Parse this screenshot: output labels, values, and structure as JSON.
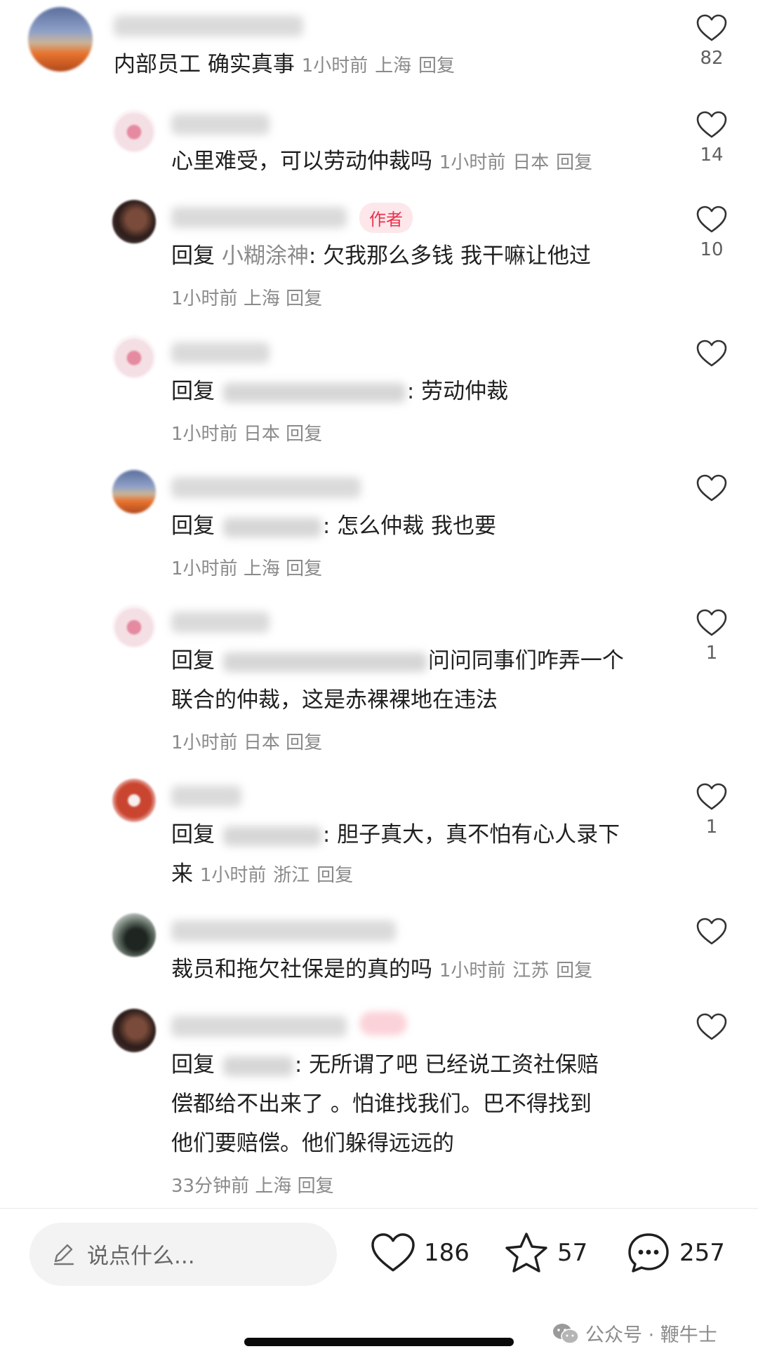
{
  "comments": [
    {
      "id": "c1",
      "text": "内部员工 确实真事",
      "time": "1小时前",
      "location": "上海",
      "reply_label": "回复",
      "likes": "82"
    },
    {
      "id": "c2",
      "text": "心里难受，可以劳动仲裁吗",
      "time": "1小时前",
      "location": "日本",
      "reply_label": "回复",
      "likes": "14"
    },
    {
      "id": "c3",
      "author_badge": "作者",
      "prefix": "回复",
      "target": "小糊涂神",
      "content": ": 欠我那么多钱 我干嘛让他过",
      "time": "1小时前",
      "location": "上海",
      "reply_label": "回复",
      "likes": "10"
    },
    {
      "id": "c4",
      "prefix": "回复",
      "content": ": 劳动仲裁",
      "time": "1小时前",
      "location": "日本",
      "reply_label": "回复"
    },
    {
      "id": "c5",
      "prefix": "回复",
      "content": ": 怎么仲裁 我也要",
      "time": "1小时前",
      "location": "上海",
      "reply_label": "回复"
    },
    {
      "id": "c6",
      "prefix": "回复",
      "content_line1": "问问同事们咋弄一个",
      "content_line2": "联合的仲裁，这是赤裸裸地在违法",
      "time": "1小时前",
      "location": "日本",
      "reply_label": "回复",
      "likes": "1"
    },
    {
      "id": "c7",
      "prefix": "回复",
      "content_line1": ": 胆子真大，真不怕有心人录下",
      "content_line2": "来",
      "time": "1小时前",
      "location": "浙江",
      "reply_label": "回复",
      "likes": "1"
    },
    {
      "id": "c8",
      "text": "裁员和拖欠社保是的真的吗",
      "time": "1小时前",
      "location": "江苏",
      "reply_label": "回复"
    },
    {
      "id": "c9",
      "prefix": "回复",
      "content_line1": ": 无所谓了吧 已经说工资社保赔",
      "content_line2": "偿都给不出来了 。怕谁找我们。巴不得找到",
      "content_line3": "他们要赔偿。他们躲得远远的",
      "time": "33分钟前",
      "location": "上海",
      "reply_label": "回复"
    }
  ],
  "bottom_bar": {
    "input_placeholder": "说点什么...",
    "likes": "186",
    "favorites": "57",
    "comments": "257"
  },
  "watermark": {
    "text": "公众号 · 鞭牛士"
  },
  "icons": {
    "heart": "heart-icon",
    "star": "star-icon",
    "comment": "comment-bubble-icon",
    "pencil": "pencil-icon",
    "wechat": "wechat-icon"
  },
  "colors": {
    "author_badge_text": "#e8334d",
    "author_badge_bg": "#fde7ea",
    "meta_grey": "#8a8a8a"
  }
}
